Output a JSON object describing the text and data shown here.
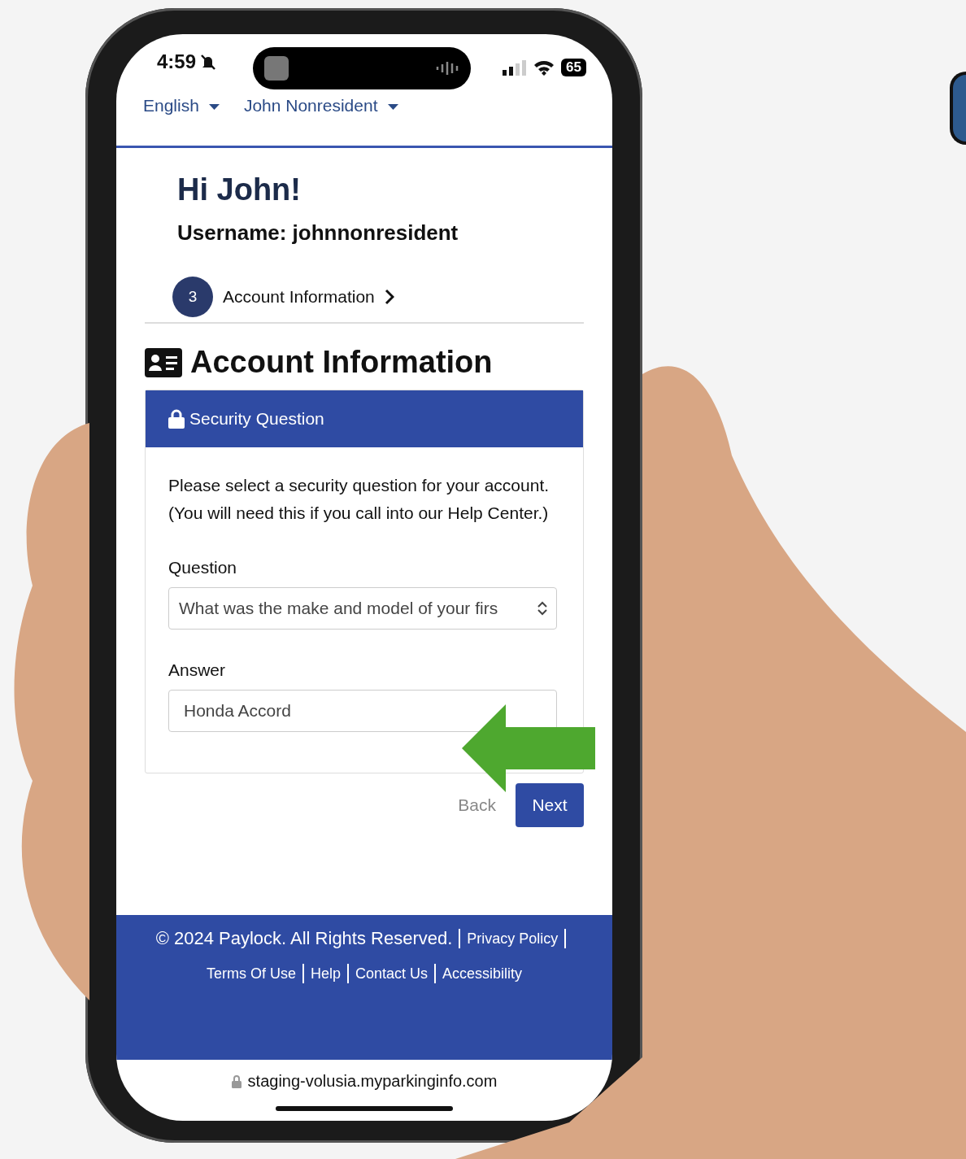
{
  "status_bar": {
    "time": "4:59",
    "battery": "65"
  },
  "nav": {
    "language": "English",
    "user": "John Nonresident"
  },
  "greeting": "Hi John!",
  "username": "Username: johnnonresident",
  "step": {
    "number": "3",
    "label": "Account Information"
  },
  "section_title": "Account Information",
  "card": {
    "title": "Security Question",
    "description": "Please select a security question for your account. (You will need this if you call into our Help Center.)",
    "question_label": "Question",
    "question_value": "What was the make and model of your firs",
    "answer_label": "Answer",
    "answer_value": "Honda Accord"
  },
  "buttons": {
    "back": "Back",
    "next": "Next"
  },
  "footer": {
    "copyright": "© 2024 Paylock. All Rights Reserved.",
    "privacy_link": "Privacy Policy",
    "links": [
      {
        "label": "Terms Of Use"
      },
      {
        "label": "Help"
      },
      {
        "label": "Contact Us"
      },
      {
        "label": "Accessibility"
      }
    ]
  },
  "url": "staging-volusia.myparkinginfo.com"
}
